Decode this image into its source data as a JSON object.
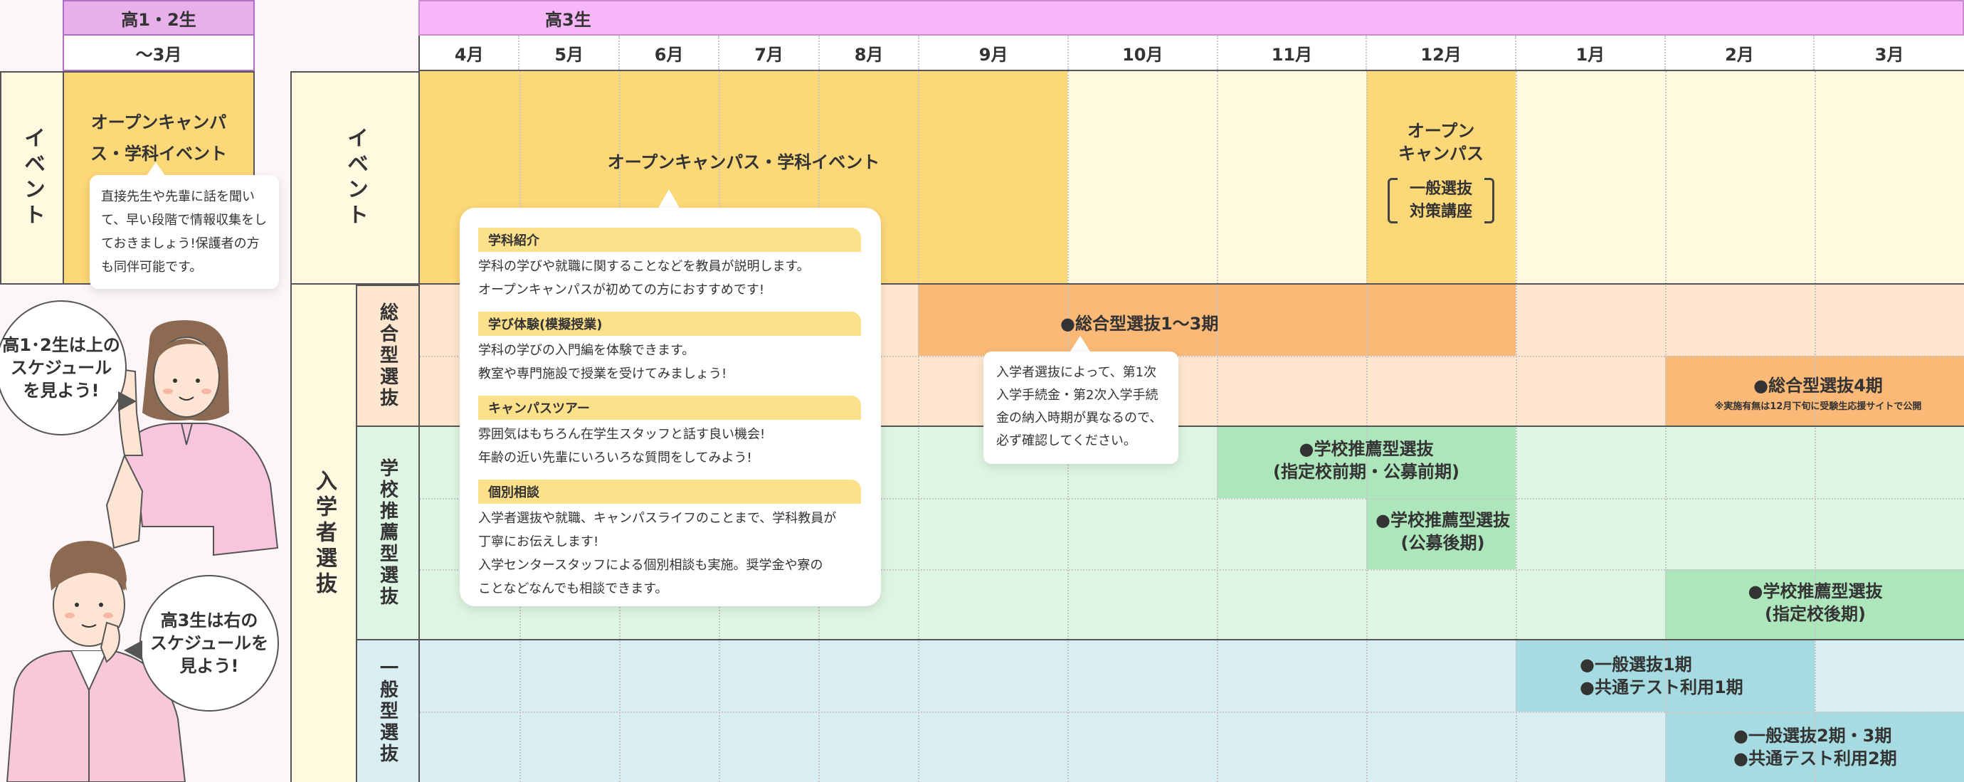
{
  "header": {
    "junior_label": "高1・2生",
    "junior_sub": "～3月",
    "senior_label": "高3生",
    "months": [
      "4月",
      "5月",
      "6月",
      "7月",
      "8月",
      "9月",
      "10月",
      "11月",
      "12月",
      "1月",
      "2月",
      "3月"
    ]
  },
  "rows": {
    "event": "イベント",
    "admission": "入学者選抜",
    "sogo": "総合型選抜",
    "suisen": "学校推薦型選抜",
    "ippan": "一般型選抜"
  },
  "junior": {
    "event_title": "オープンキャンパス・学科イベント",
    "note": "直接先生や先輩に話を聞いて、早い段階で情報収集をしておきましょう!保護者の方も同伴可能です。"
  },
  "events": {
    "main": "オープンキャンパス・学科イベント",
    "dec_title": "オープン\nキャンパス",
    "dec_sub": "一般選抜\n対策講座"
  },
  "popup": {
    "items": [
      {
        "tag": "学科紹介",
        "text": "学科の学びや就職に関することなどを教員が説明します。\nオープンキャンパスが初めての方におすすめです!"
      },
      {
        "tag": "学び体験(模擬授業)",
        "text": "学科の学びの入門編を体験できます。\n教室や専門施設で授業を受けてみましょう!"
      },
      {
        "tag": "キャンパスツアー",
        "text": "雰囲気はもちろん在学生スタッフと話す良い機会!\n年齢の近い先輩にいろいろな質問をしてみよう!"
      },
      {
        "tag": "個別相談",
        "text": "入学者選抜や就職、キャンパスライフのことまで、学科教員が\n丁寧にお伝えします!\n入学センタースタッフによる個別相談も実施。奨学金や寮の\nことなどなんでも相談できます。"
      }
    ]
  },
  "selections": {
    "sogo1": "●総合型選抜1～3期",
    "sogo_note": "入学者選抜によって、第1次入学手続金・第2次入学手続金の納入時期が異なるので、必ず確認してください。",
    "sogo4": "●総合型選抜4期",
    "sogo4_note": "※実施有無は12月下旬に受験生応援サイトで公開",
    "suisen1": "●学校推薦型選抜\n(指定校前期・公募前期)",
    "suisen2": "●学校推薦型選抜\n(公募後期)",
    "suisen3": "●学校推薦型選抜\n(指定校後期)",
    "ippan1": "●一般選抜1期\n●共通テスト利用1期",
    "ippan2": "●一般選抜2期・3期\n●共通テスト利用2期"
  },
  "speech": {
    "girl": "高1･2生は上の\nスケジュール\nを見よう!",
    "boy": "高3生は右の\nスケジュールを\n見よう!"
  },
  "colors": {
    "event_yellow": "#fdd878",
    "event_light": "#fff9e0",
    "sogo_light": "#ffe7cf",
    "sogo_dark": "#fbb978",
    "suisen_light": "#dff5e3",
    "suisen_dark": "#aee6bb",
    "ippan_light": "#d9eef2",
    "ippan_dark": "#a6dbe1"
  }
}
